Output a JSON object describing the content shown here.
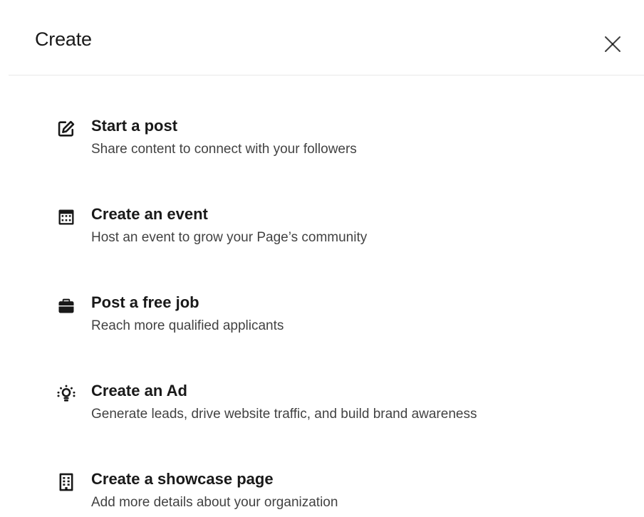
{
  "dialog": {
    "title": "Create",
    "close_icon": "close-icon"
  },
  "items": [
    {
      "label": "Start a post",
      "description": "Share content to connect with your followers",
      "icon": "compose-icon"
    },
    {
      "label": "Create an event",
      "description": "Host an event to grow your Page’s community",
      "icon": "calendar-icon"
    },
    {
      "label": "Post a free job",
      "description": "Reach more qualified applicants",
      "icon": "briefcase-icon"
    },
    {
      "label": "Create an Ad",
      "description": "Generate leads, drive website traffic, and build brand awareness",
      "icon": "lightbulb-icon"
    },
    {
      "label": "Create a showcase page",
      "description": "Add more details about your organization",
      "icon": "building-icon"
    }
  ]
}
